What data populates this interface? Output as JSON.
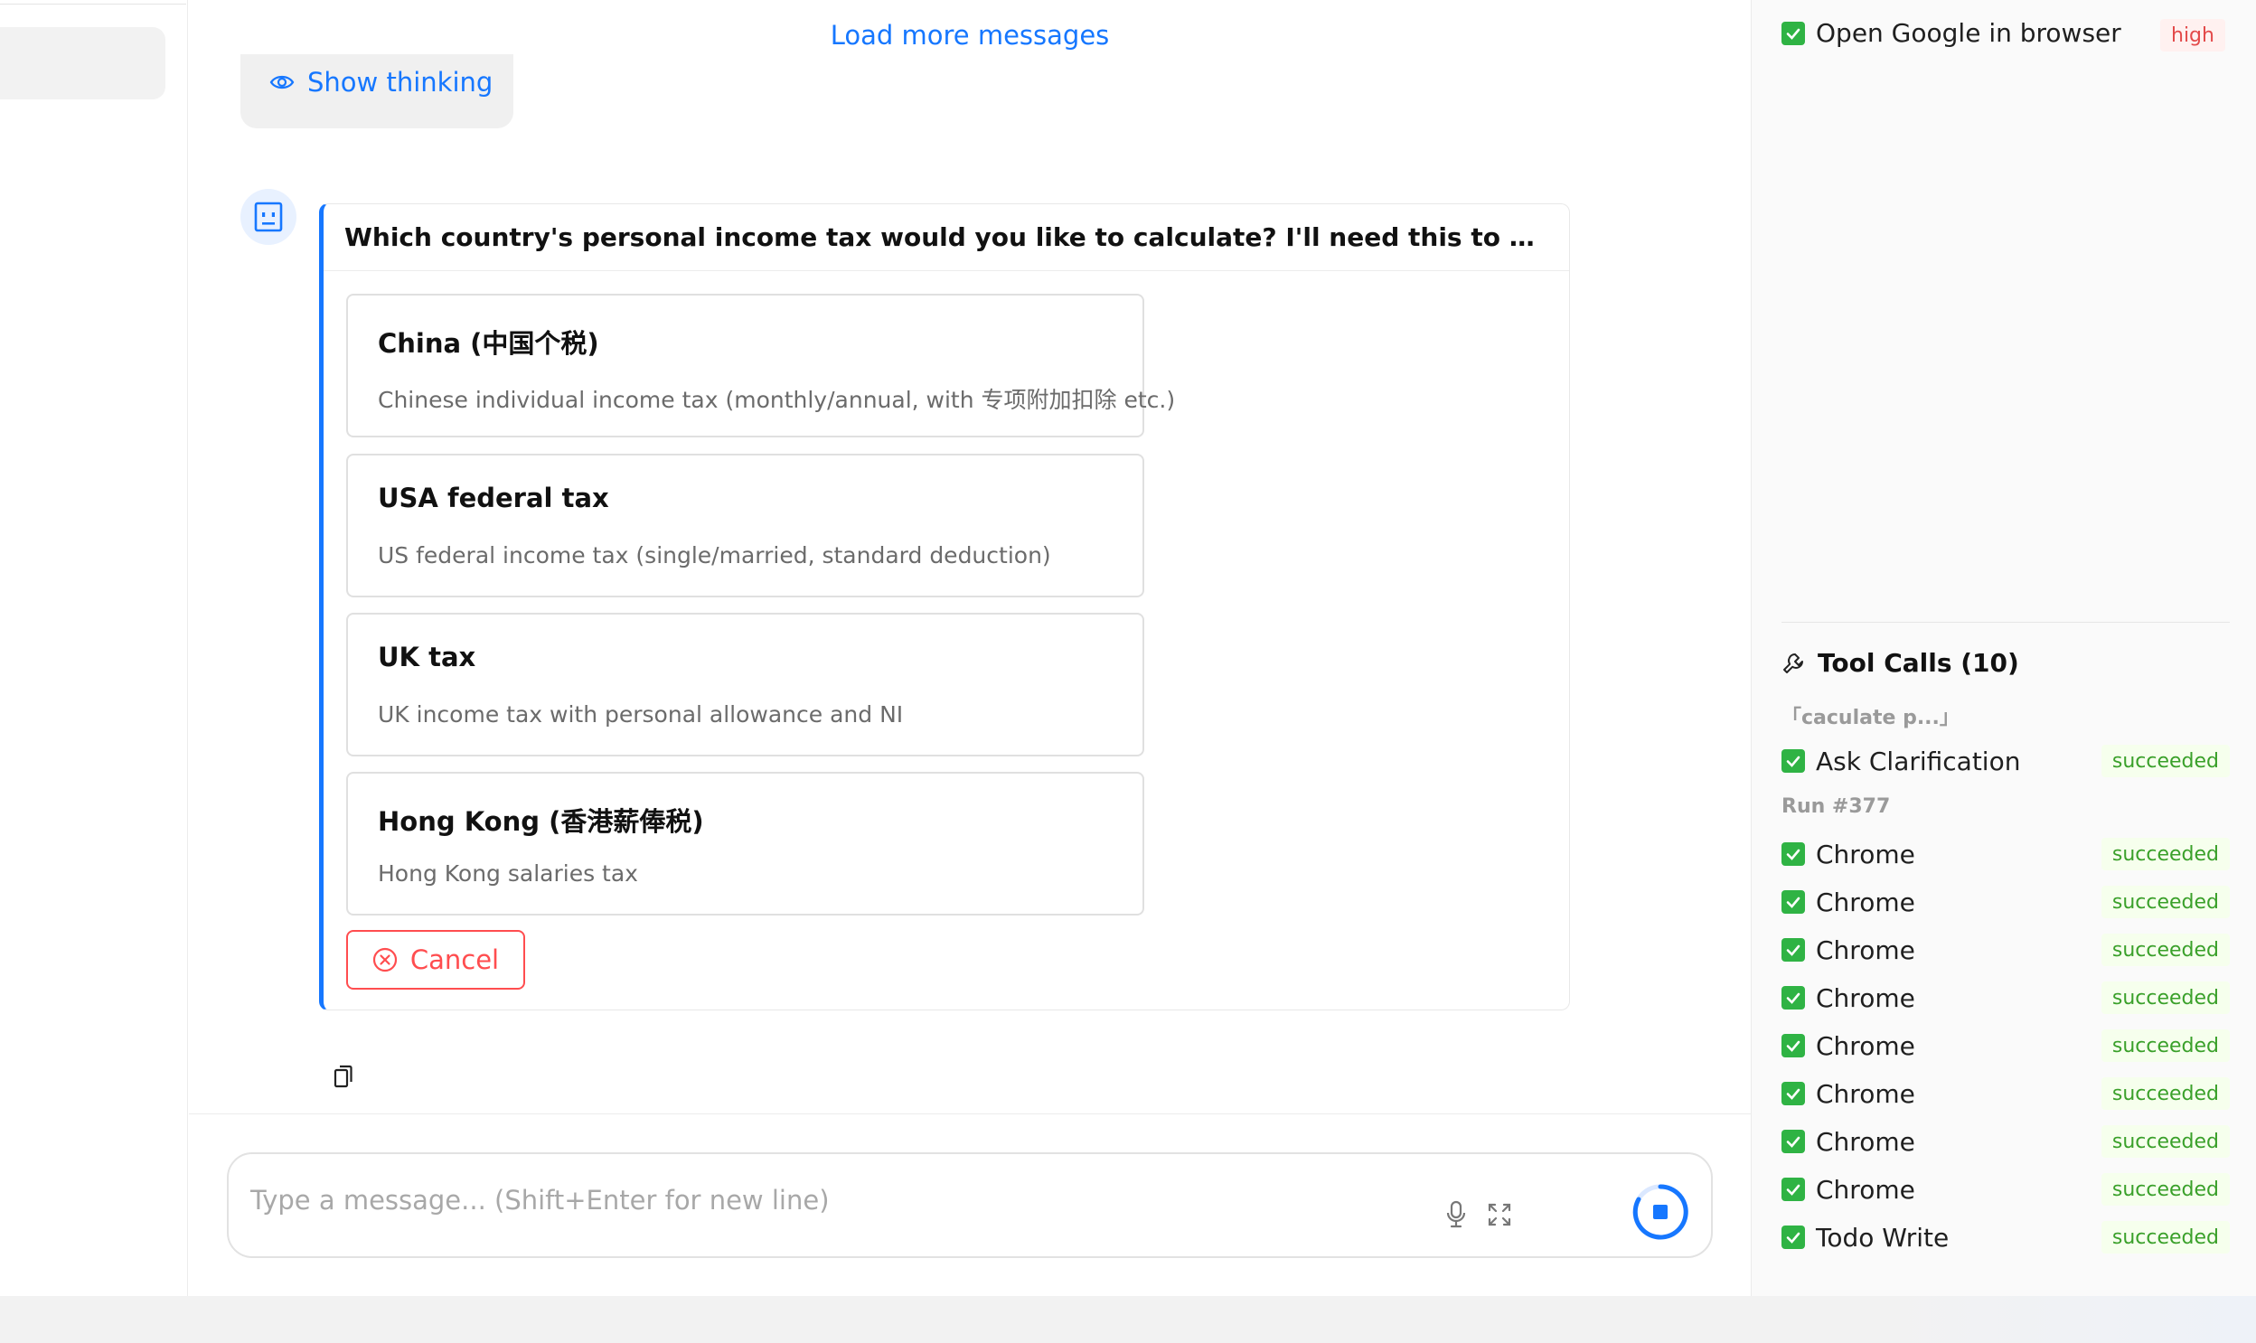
{
  "chat": {
    "load_more_label": "Load more messages",
    "show_thinking_label": "Show thinking",
    "question": "Which country's personal income tax would you like to calculate? I'll need this to determine th...",
    "options": [
      {
        "title": "China (中国个税)",
        "description": "Chinese individual income tax (monthly/annual, with 专项附加扣除 etc.)"
      },
      {
        "title": "USA federal tax",
        "description": "US federal income tax (single/married, standard deduction)"
      },
      {
        "title": "UK tax",
        "description": "UK income tax with personal allowance and NI"
      },
      {
        "title": "Hong Kong (香港薪俸税)",
        "description": "Hong Kong salaries tax"
      }
    ],
    "cancel_label": "Cancel"
  },
  "composer": {
    "placeholder": "Type a message... (Shift+Enter for new line)"
  },
  "right_panel": {
    "task": {
      "label": "Open Google in browser",
      "priority": "high"
    },
    "tool_calls": {
      "title": "Tool Calls (10)",
      "groups": [
        {
          "label": "「caculate p...」",
          "items": [
            {
              "name": "Ask Clarification",
              "status": "succeeded"
            }
          ]
        },
        {
          "label": "Run #377",
          "items": [
            {
              "name": "Chrome",
              "status": "succeeded"
            },
            {
              "name": "Chrome",
              "status": "succeeded"
            },
            {
              "name": "Chrome",
              "status": "succeeded"
            },
            {
              "name": "Chrome",
              "status": "succeeded"
            },
            {
              "name": "Chrome",
              "status": "succeeded"
            },
            {
              "name": "Chrome",
              "status": "succeeded"
            },
            {
              "name": "Chrome",
              "status": "succeeded"
            },
            {
              "name": "Chrome",
              "status": "succeeded"
            },
            {
              "name": "Todo Write",
              "status": "succeeded"
            }
          ]
        }
      ]
    }
  },
  "colors": {
    "accent": "#1677ff",
    "danger": "#ff4d4f",
    "success": "#2fb344"
  }
}
